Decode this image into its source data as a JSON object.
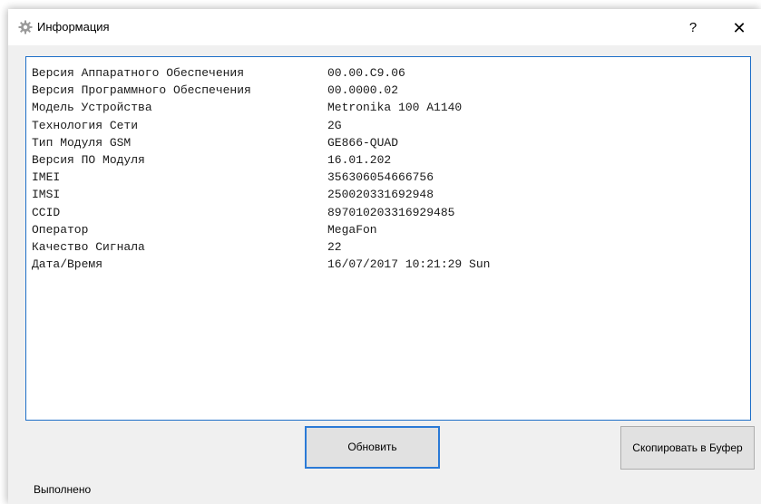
{
  "window": {
    "title": "Информация",
    "help_label": "?",
    "close_label": "✕",
    "icon": "gear-icon"
  },
  "info": {
    "rows": [
      {
        "label": "Версия Аппаратного Обеспечения",
        "value": "00.00.C9.06"
      },
      {
        "label": "Версия Программного Обеспечения",
        "value": "00.0000.02"
      },
      {
        "label": "Модель Устройства",
        "value": "Metronika 100 A1140"
      },
      {
        "label": "Технология Сети",
        "value": "2G"
      },
      {
        "label": "Тип Модуля GSM",
        "value": "GE866-QUAD"
      },
      {
        "label": "Версия ПО Модуля",
        "value": "16.01.202"
      },
      {
        "label": "IMEI",
        "value": "356306054666756"
      },
      {
        "label": "IMSI",
        "value": "250020331692948"
      },
      {
        "label": "CCID",
        "value": "897010203316929485"
      },
      {
        "label": "Оператор",
        "value": "MegaFon"
      },
      {
        "label": "Качество Сигнала",
        "value": "22"
      },
      {
        "label": "Дата/Время",
        "value": "16/07/2017 10:21:29 Sun"
      }
    ]
  },
  "buttons": {
    "refresh_label": "Обновить",
    "copy_label": "Скопировать в Буфер"
  },
  "status": {
    "text": "Выполнено"
  },
  "colors": {
    "accent": "#2b7ad6",
    "background": "#f0f0f0",
    "button": "#e1e1e1"
  }
}
